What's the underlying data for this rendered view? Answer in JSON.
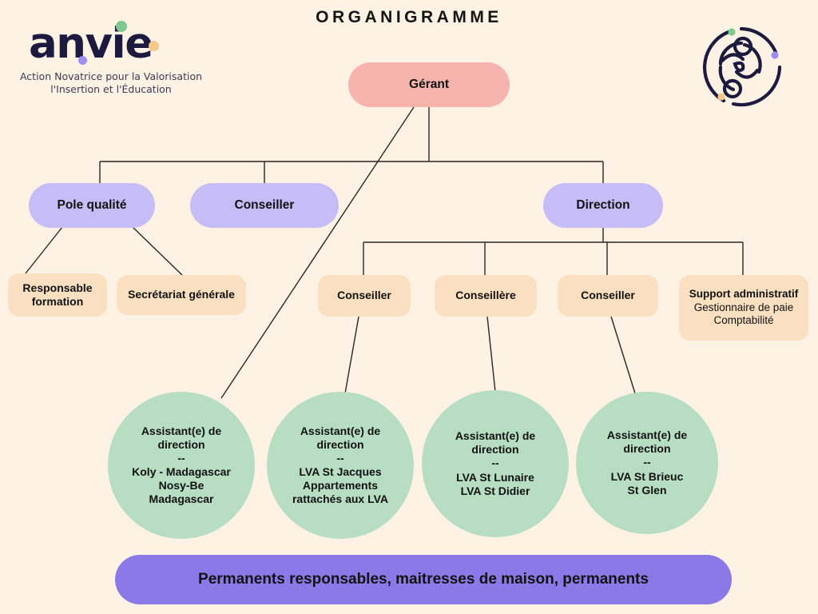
{
  "page": {
    "title": "ORGANIGRAMME",
    "background_color": "#fdf2e4"
  },
  "logo": {
    "wordmark": "anvie",
    "tagline_line1": "Action Novatrice pour la Valorisation",
    "tagline_line2": "l'Insertion et l'Éducation",
    "wordmark_color": "#1d1a40",
    "accent_dots": [
      "#a08ef0",
      "#7dc98f",
      "#f6c98a"
    ]
  },
  "emblem": {
    "ring_color": "#1d1a40",
    "dots": [
      "#7dc98f",
      "#a08ef0",
      "#f6c98a"
    ]
  },
  "chart_data": {
    "type": "diagram",
    "title": "ORGANIGRAMME",
    "node_colors": {
      "manager": "#f7b3ae",
      "department": "#c6bdf7",
      "sub": "#fadfc0",
      "circle": "#b7ddc2",
      "footer": "#8c79e8"
    },
    "nodes": [
      {
        "id": "manager",
        "label": "Gérant",
        "level": 1,
        "shape": "pill",
        "color": "#f7b3ae"
      },
      {
        "id": "pole-qualite",
        "label": "Pole qualité",
        "level": 2,
        "shape": "pill",
        "color": "#c6bdf7"
      },
      {
        "id": "conseiller-top",
        "label": "Conseiller",
        "level": 2,
        "shape": "pill",
        "color": "#c6bdf7"
      },
      {
        "id": "direction",
        "label": "Direction",
        "level": 2,
        "shape": "pill",
        "color": "#c6bdf7"
      },
      {
        "id": "responsable-formation",
        "label": "Responsable formation",
        "level": 3,
        "shape": "rounded-rect",
        "color": "#fadfc0"
      },
      {
        "id": "secretariat-generale",
        "label": "Secrétariat générale",
        "level": 3,
        "shape": "rounded-rect",
        "color": "#fadfc0"
      },
      {
        "id": "conseiller-1",
        "label": "Conseiller",
        "level": 3,
        "shape": "rounded-rect",
        "color": "#fadfc0"
      },
      {
        "id": "conseillere",
        "label": "Conseillère",
        "level": 3,
        "shape": "rounded-rect",
        "color": "#fadfc0"
      },
      {
        "id": "conseiller-2",
        "label": "Conseiller",
        "level": 3,
        "shape": "rounded-rect",
        "color": "#fadfc0"
      },
      {
        "id": "support-administratif",
        "label": "Support administratif",
        "level": 3,
        "shape": "rounded-rect",
        "color": "#fadfc0"
      },
      {
        "id": "assistant-1",
        "label": "Assistant(e) de direction -- Koly - Madagascar Nosy-Be Madagascar",
        "level": 4,
        "shape": "circle",
        "color": "#b7ddc2"
      },
      {
        "id": "assistant-2",
        "label": "Assistant(e) de direction -- LVA St Jacques Appartements rattachés aux LVA",
        "level": 4,
        "shape": "circle",
        "color": "#b7ddc2"
      },
      {
        "id": "assistant-3",
        "label": "Assistant(e) de direction -- LVA  St Lunaire LVA St Didier",
        "level": 4,
        "shape": "circle",
        "color": "#b7ddc2"
      },
      {
        "id": "assistant-4",
        "label": "Assistant(e) de direction -- LVA St Brieuc St Glen",
        "level": 4,
        "shape": "circle",
        "color": "#b7ddc2"
      },
      {
        "id": "footer",
        "label": "Permanents responsables, maitresses de maison, permanents",
        "level": 5,
        "shape": "pill",
        "color": "#8c79e8"
      }
    ],
    "edges": [
      {
        "from": "manager",
        "to": "pole-qualite"
      },
      {
        "from": "manager",
        "to": "conseiller-top"
      },
      {
        "from": "manager",
        "to": "direction"
      },
      {
        "from": "manager",
        "to": "assistant-1"
      },
      {
        "from": "pole-qualite",
        "to": "responsable-formation"
      },
      {
        "from": "pole-qualite",
        "to": "secretariat-generale"
      },
      {
        "from": "direction",
        "to": "conseiller-1"
      },
      {
        "from": "direction",
        "to": "conseillere"
      },
      {
        "from": "direction",
        "to": "conseiller-2"
      },
      {
        "from": "direction",
        "to": "support-administratif"
      },
      {
        "from": "conseiller-1",
        "to": "assistant-2"
      },
      {
        "from": "conseillere",
        "to": "assistant-3"
      },
      {
        "from": "conseiller-2",
        "to": "assistant-4"
      }
    ]
  },
  "nodes": {
    "manager": {
      "label": "Gérant"
    },
    "pole_qualite": {
      "label": "Pole qualité"
    },
    "conseiller_top": {
      "label": "Conseiller"
    },
    "direction": {
      "label": "Direction"
    },
    "responsable_formation": {
      "line1": "Responsable",
      "line2": "formation"
    },
    "secretariat_generale": {
      "label": "Secrétariat générale"
    },
    "conseiller_1": {
      "label": "Conseiller"
    },
    "conseillere": {
      "label": "Conseillère"
    },
    "conseiller_2": {
      "label": "Conseiller"
    },
    "support_administratif": {
      "head": "Support administratif",
      "line1": "Gestionnaire de paie",
      "line2": "Comptabilité"
    },
    "assistant_1": {
      "role1": "Assistant(e) de",
      "role2": "direction",
      "sep": "--",
      "line1": "Koly - Madagascar",
      "line2": "Nosy-Be",
      "line3": "Madagascar"
    },
    "assistant_2": {
      "role1": "Assistant(e) de",
      "role2": "direction",
      "sep": "--",
      "line1": "LVA St Jacques",
      "line2": "Appartements",
      "line3": "rattachés aux LVA"
    },
    "assistant_3": {
      "role1": "Assistant(e) de",
      "role2": "direction",
      "sep": "--",
      "line1": "LVA  St Lunaire",
      "line2": "LVA St Didier",
      "line3": ""
    },
    "assistant_4": {
      "role1": "Assistant(e) de",
      "role2": "direction",
      "sep": "--",
      "line1": "LVA St Brieuc",
      "line2": "St Glen",
      "line3": ""
    },
    "footer": {
      "label": "Permanents responsables, maitresses de maison, permanents"
    }
  }
}
